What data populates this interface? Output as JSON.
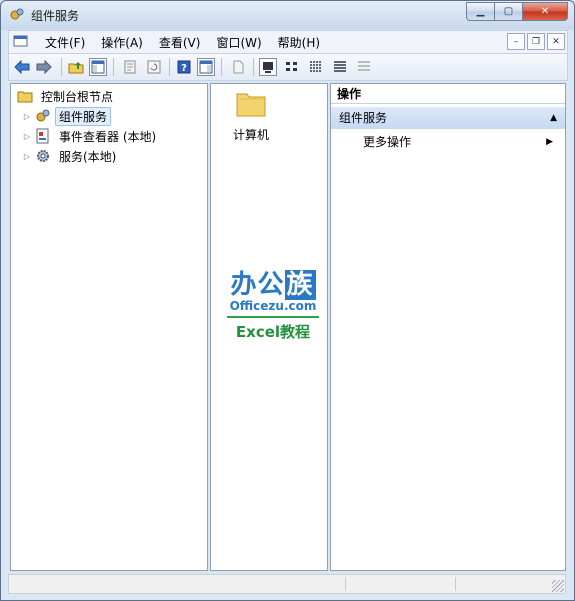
{
  "window": {
    "title": "组件服务"
  },
  "menu": {
    "items": [
      "文件(F)",
      "操作(A)",
      "查看(V)",
      "窗口(W)",
      "帮助(H)"
    ]
  },
  "tree": {
    "root": "控制台根节点",
    "items": [
      {
        "label": "组件服务",
        "icon": "gears-icon",
        "selected": true
      },
      {
        "label": "事件查看器 (本地)",
        "icon": "event-viewer-icon",
        "selected": false
      },
      {
        "label": "服务(本地)",
        "icon": "services-gear-icon",
        "selected": false
      }
    ]
  },
  "content": {
    "items": [
      {
        "label": "计算机",
        "icon": "folder-icon"
      }
    ]
  },
  "watermark": {
    "title": "办公族",
    "site": "Officezu.com",
    "subtitle": "Excel教程"
  },
  "actions": {
    "header": "操作",
    "section": "组件服务",
    "items": [
      {
        "label": "更多操作"
      }
    ]
  },
  "colors": {
    "accent": "#2a79c8",
    "selection": "#e3eefc",
    "watermark_green": "#27903f"
  }
}
